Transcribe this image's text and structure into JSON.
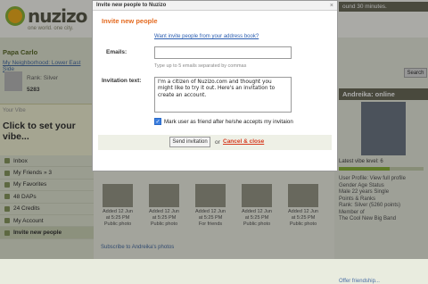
{
  "app": {
    "logo_text": "nuzizo",
    "tagline": "one world. one city.",
    "top_right_text": "ound 30 minutes."
  },
  "sidebar": {
    "username": "Papa Carlo",
    "neighborhood_link": "My Neighborhood: Lower East Side",
    "rank": "Rank: Silver",
    "points": "5283",
    "vibe_label": "Your Vibe",
    "vibe_prompt": "Click to set your vibe...",
    "menu": [
      {
        "label": "Inbox",
        "icon": "inbox-icon"
      },
      {
        "label": "My Friends » 3",
        "icon": "friends-icon"
      },
      {
        "label": "My Favorites",
        "icon": "star-icon"
      },
      {
        "label": "48 DAPs",
        "icon": "dap-icon"
      },
      {
        "label": "24 Credits",
        "icon": "credits-icon"
      },
      {
        "label": "My Account",
        "icon": "account-icon"
      },
      {
        "label": "Invite new people",
        "icon": "invite-icon"
      }
    ]
  },
  "center": {
    "thumbnails": [
      {
        "added": "Added 12 Jun",
        "time": "at 5:25 PM",
        "privacy": "Public photo"
      },
      {
        "added": "Added 12 Jun",
        "time": "at 5:25 PM",
        "privacy": "Public photo"
      },
      {
        "added": "Added 12 Jun",
        "time": "at 5:25 PM",
        "privacy": "For friends"
      },
      {
        "added": "Added 12 Jun",
        "time": "at 5:25 PM",
        "privacy": "Public photo"
      },
      {
        "added": "Added 12 Jun",
        "time": "at 5:25 PM",
        "privacy": "Public photo"
      }
    ],
    "subscribe_text": "Subscribe to Andreika's photos"
  },
  "right": {
    "search_label": "Search",
    "profile_title": "Andreika: online",
    "vibe_level": "Latest vibe level: 6",
    "vibe_level_fraction": 0.6,
    "profile_lines": [
      "User Profile:  View full profile",
      "Gender    Age       Status",
      "Male       22 years   Single",
      "Points & Ranks",
      "Rank: Silver (5260 points)",
      "Member of",
      "The Cool New Big Band"
    ],
    "offer_friendship": "Offer friendship..."
  },
  "modal": {
    "window_title": "Invite new people to Nuzizo",
    "close_symbol": "×",
    "heading": "Invite new people",
    "address_book_link": "Want invite people from your address book?",
    "emails_label": "Emails:",
    "emails_value": "",
    "emails_hint": "Type up to 5 emails separated by commas",
    "invitation_label": "Invitation text:",
    "invitation_text": "I'm a citizen of Nuzizo.com and thought you might like to try it out. Here's an invitation to create an account.",
    "checkbox_checked": true,
    "checkbox_label": "Mark user as friend after he/she accepts my invitaion",
    "send_button": "Send invitation",
    "or_text": "or",
    "cancel_link": "Cancel & close"
  }
}
